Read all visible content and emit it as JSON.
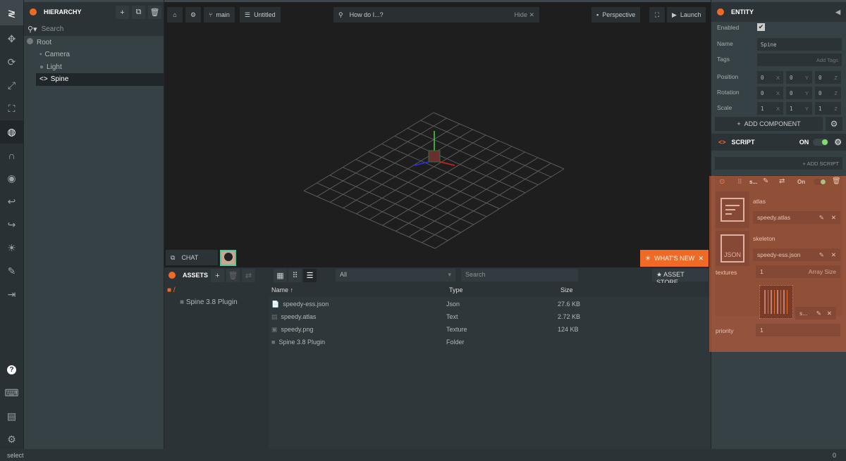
{
  "colors": {
    "accent": "#f06a25",
    "selection_overlay": "#cd5f37",
    "toggle_on": "#7ee06b"
  },
  "toolbar": {
    "icons": [
      "logo-icon",
      "translate-icon",
      "rotate-icon",
      "scale-icon",
      "resize-icon",
      "world-icon",
      "magnet-icon",
      "eye-icon",
      "undo-icon",
      "redo-icon",
      "lightbulb-icon",
      "edit-icon",
      "publish-icon",
      "help-icon",
      "keyboard-icon",
      "chat-icon",
      "settings-icon"
    ]
  },
  "hierarchy": {
    "title": "HIERARCHY",
    "search_placeholder": "Search",
    "items": [
      {
        "label": "Root"
      },
      {
        "label": "Camera"
      },
      {
        "label": "Light"
      },
      {
        "label": "Spine"
      }
    ]
  },
  "viewport": {
    "branch": "main",
    "scene": "Untitled",
    "search_placeholder": "How do I...?",
    "hide": "Hide",
    "camera": "Perspective",
    "launch": "Launch",
    "chat": "CHAT",
    "whats_new": "WHAT'S NEW"
  },
  "assets": {
    "title": "ASSETS",
    "filter": "All",
    "search_placeholder": "Search",
    "store": "ASSET STORE",
    "tree": [
      {
        "label": "/"
      },
      {
        "label": "Spine 3.8 Plugin"
      }
    ],
    "columns": [
      "Name",
      "Type",
      "Size"
    ],
    "rows": [
      {
        "name": "speedy-ess.json",
        "type": "Json",
        "size": "27.6 KB"
      },
      {
        "name": "speedy.atlas",
        "type": "Text",
        "size": "2.72 KB"
      },
      {
        "name": "speedy.png",
        "type": "Texture",
        "size": "124 KB"
      },
      {
        "name": "Spine 3.8 Plugin",
        "type": "Folder",
        "size": ""
      }
    ]
  },
  "entity": {
    "title": "ENTITY",
    "enabled_label": "Enabled",
    "enabled": true,
    "name_label": "Name",
    "name": "Spine",
    "tags_label": "Tags",
    "tags_placeholder": "Add Tags",
    "position_label": "Position",
    "position": [
      "0",
      "0",
      "0"
    ],
    "rotation_label": "Rotation",
    "rotation": [
      "0",
      "0",
      "0"
    ],
    "scale_label": "Scale",
    "scale": [
      "1",
      "1",
      "1"
    ],
    "axes": [
      "X",
      "Y",
      "Z"
    ],
    "add_component": "ADD COMPONENT"
  },
  "script": {
    "title": "SCRIPT",
    "on": "ON",
    "add_script": "+ ADD SCRIPT",
    "instance_name": "s...",
    "instance_on": "On",
    "atlas_label": "atlas",
    "atlas_value": "speedy.atlas",
    "skeleton_label": "skeleton",
    "skeleton_value": "speedy-ess.json",
    "json_badge": "JSON",
    "textures_label": "textures",
    "textures_count": "1",
    "array_size": "Array Size",
    "texture_item": "s...",
    "priority_label": "priority",
    "priority": "1"
  },
  "status": {
    "text": "select",
    "count": "0"
  }
}
